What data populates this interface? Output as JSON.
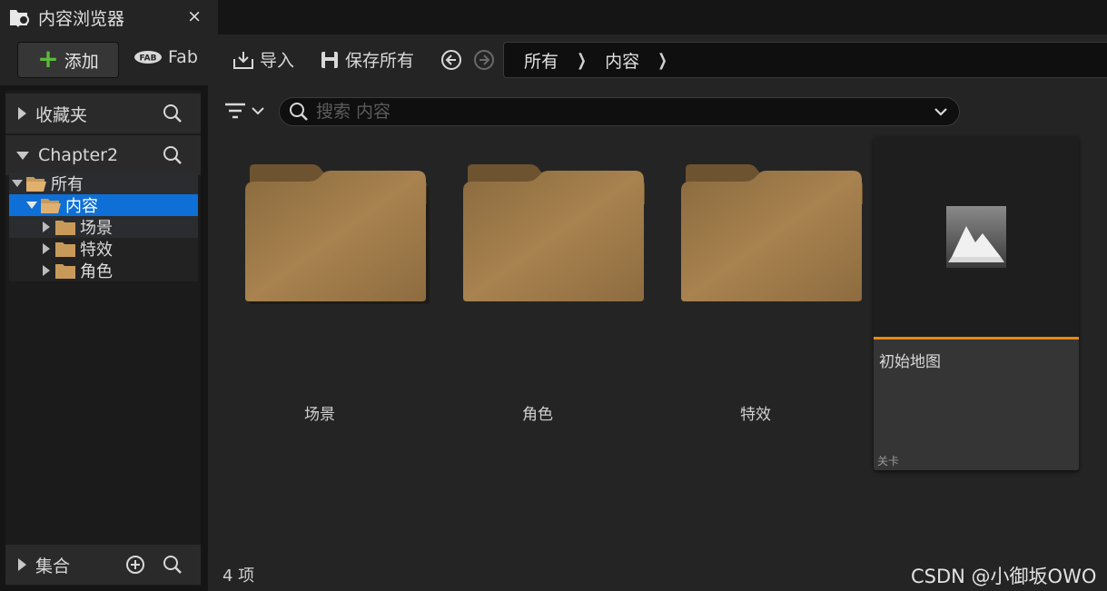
{
  "tab": {
    "title": "内容浏览器",
    "close": "×"
  },
  "toolbar": {
    "add_label": "添加",
    "fab_label": "Fab",
    "import_label": "导入",
    "save_all_label": "保存所有"
  },
  "breadcrumb": [
    "所有",
    "内容"
  ],
  "left": {
    "favorites_label": "收藏夹",
    "project_label": "Chapter2",
    "collections_label": "集合",
    "tree": [
      {
        "label": "所有",
        "level": 0,
        "expanded": true
      },
      {
        "label": "内容",
        "level": 1,
        "expanded": true,
        "selected": true
      },
      {
        "label": "场景",
        "level": 2,
        "expanded": false
      },
      {
        "label": "特效",
        "level": 2,
        "expanded": false
      },
      {
        "label": "角色",
        "level": 2,
        "expanded": false
      }
    ]
  },
  "search": {
    "placeholder": "搜索 内容"
  },
  "tiles": [
    "场景",
    "角色",
    "特效"
  ],
  "asset": {
    "name": "初始地图",
    "type": "关卡"
  },
  "status": {
    "count": "4 项"
  },
  "watermark": "CSDN @小御坂OWO",
  "colors": {
    "accent": "#0e6fd6",
    "folder": "#9c7a49",
    "add_plus": "#5dbb3a",
    "asset_bar": "#e88a12"
  }
}
